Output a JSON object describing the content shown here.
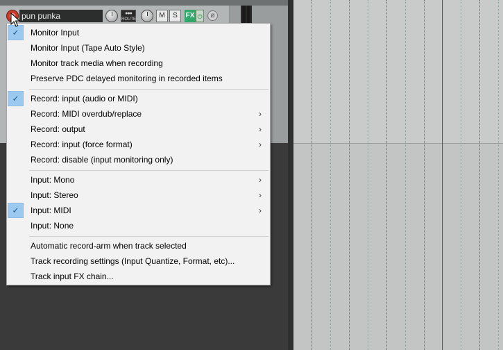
{
  "track": {
    "name": "pun punka",
    "route_label": "ROUTE",
    "mute_label": "M",
    "solo_label": "S",
    "fx_label": "FX",
    "fx_power_glyph": "⏻",
    "phase_glyph": "ø"
  },
  "menu": {
    "items": [
      {
        "label": "Monitor Input",
        "checked": true,
        "submenu": false
      },
      {
        "label": "Monitor Input (Tape Auto Style)",
        "checked": false,
        "submenu": false
      },
      {
        "label": "Monitor track media when recording",
        "checked": false,
        "submenu": false
      },
      {
        "label": "Preserve PDC delayed monitoring in recorded items",
        "checked": false,
        "submenu": false
      },
      {
        "label": "Record: input (audio or MIDI)",
        "checked": true,
        "submenu": false
      },
      {
        "label": "Record: MIDI overdub/replace",
        "checked": false,
        "submenu": true
      },
      {
        "label": "Record: output",
        "checked": false,
        "submenu": true
      },
      {
        "label": "Record: input (force format)",
        "checked": false,
        "submenu": true
      },
      {
        "label": "Record: disable (input monitoring only)",
        "checked": false,
        "submenu": false
      },
      {
        "label": "Input: Mono",
        "checked": false,
        "submenu": true
      },
      {
        "label": "Input: Stereo",
        "checked": false,
        "submenu": true
      },
      {
        "label": "Input: MIDI",
        "checked": true,
        "submenu": true
      },
      {
        "label": "Input: None",
        "checked": false,
        "submenu": false
      },
      {
        "label": "Automatic record-arm when track selected",
        "checked": false,
        "submenu": false
      },
      {
        "label": "Track recording settings (Input Quantize, Format, etc)...",
        "checked": false,
        "submenu": false
      },
      {
        "label": "Track input FX chain...",
        "checked": false,
        "submenu": false
      }
    ],
    "check_glyph": "✓",
    "arrow_glyph": "›"
  },
  "colors": {
    "record_arm": "#c93a2c",
    "fx_enabled": "#2fa86a",
    "menu_check_bg": "#9cc9f0",
    "edit_cursor": "#b02222"
  }
}
